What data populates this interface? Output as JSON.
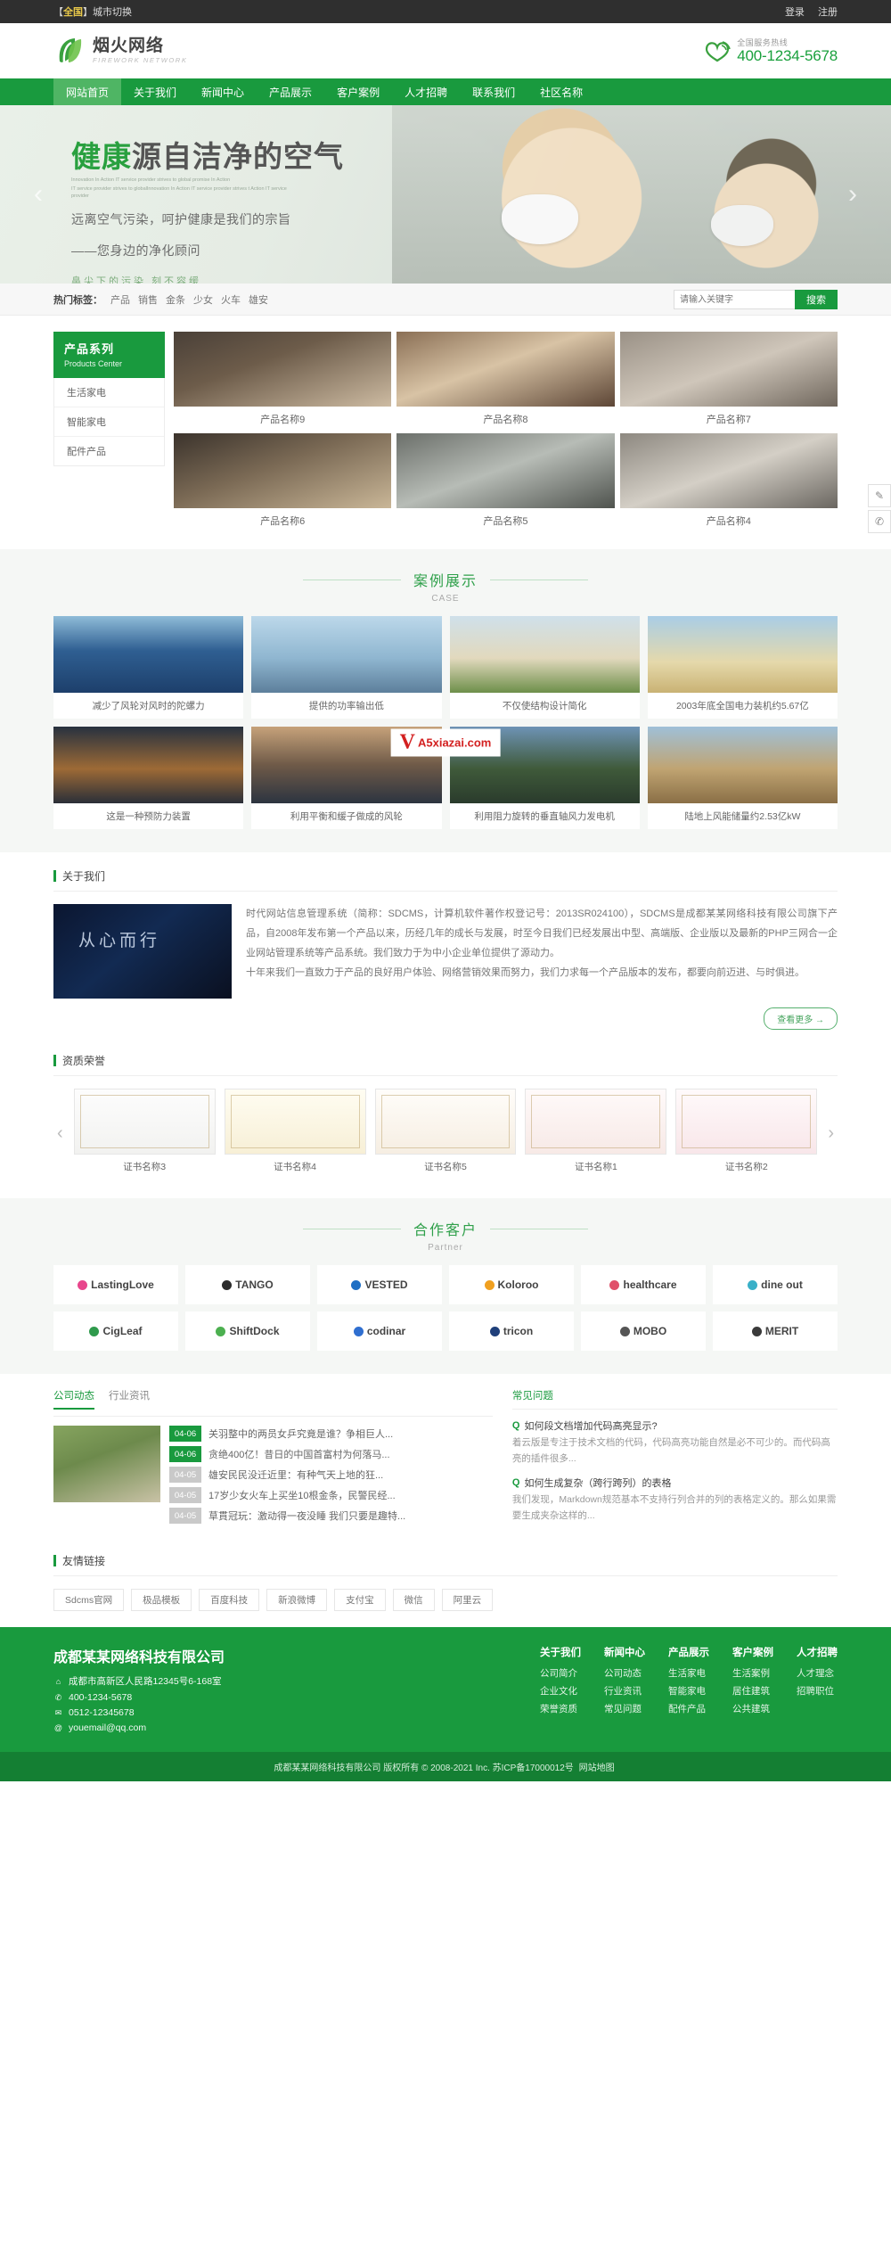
{
  "topbar": {
    "city_prefix": "【",
    "city_name": "全国",
    "city_suffix": "】城市切换",
    "login": "登录",
    "register": "注册"
  },
  "header": {
    "logo_cn": "烟火网络",
    "logo_en": "FIREWORK NETWORK",
    "hotline_label": "全国服务热线",
    "hotline_number": "400-1234-5678"
  },
  "nav": {
    "items": [
      {
        "label": "网站首页",
        "active": true
      },
      {
        "label": "关于我们",
        "active": false
      },
      {
        "label": "新闻中心",
        "active": false
      },
      {
        "label": "产品展示",
        "active": false
      },
      {
        "label": "客户案例",
        "active": false
      },
      {
        "label": "人才招聘",
        "active": false
      },
      {
        "label": "联系我们",
        "active": false
      },
      {
        "label": "社区名称",
        "active": false
      }
    ]
  },
  "hero": {
    "title_green": "健康",
    "title_rest": "源自洁净的空气",
    "sub_en_1": "Innovation In Action IT service provider strives to global promise In Action",
    "sub_en_2": "IT service provider strives to globalInnovation In Action IT service provider strives t Action IT service provider",
    "line1": "远离空气污染，呵护健康是我们的宗旨",
    "line2": "——您身边的净化顾问",
    "slogan": "鼻尖下的污染  刻不容缓",
    "arrow_left": "‹",
    "arrow_right": "›"
  },
  "dock": {
    "items": [
      {
        "name": "message-icon",
        "glyph": "✎"
      },
      {
        "name": "phone-icon",
        "glyph": "✆"
      }
    ]
  },
  "search": {
    "tags_label": "热门标签：",
    "tags": [
      "产品",
      "销售",
      "金条",
      "少女",
      "火车",
      "雄安"
    ],
    "placeholder": "请输入关键字",
    "button": "搜索"
  },
  "products": {
    "side_title_cn": "产品系列",
    "side_title_en": "Products Center",
    "categories": [
      "生活家电",
      "智能家电",
      "配件产品"
    ],
    "items": [
      {
        "caption": "产品名称9",
        "cls": "r1"
      },
      {
        "caption": "产品名称8",
        "cls": "r2"
      },
      {
        "caption": "产品名称7",
        "cls": "r3"
      },
      {
        "caption": "产品名称6",
        "cls": "r4"
      },
      {
        "caption": "产品名称5",
        "cls": "r5"
      },
      {
        "caption": "产品名称4",
        "cls": "r6"
      }
    ]
  },
  "case": {
    "title_cn": "案例展示",
    "title_en": "CASE",
    "watermark_v": "V",
    "watermark_t": "A5xiazai.com",
    "row1": [
      {
        "caption": "减少了风轮对风时的陀螺力",
        "cls": "c1"
      },
      {
        "caption": "提供的功率输出低",
        "cls": "c2"
      },
      {
        "caption": "不仅使结构设计简化",
        "cls": "c3"
      },
      {
        "caption": "2003年底全国电力装机约5.67亿",
        "cls": "c4"
      }
    ],
    "row2": [
      {
        "caption": "这是一种预防力装置",
        "cls": "c5"
      },
      {
        "caption": "利用平衡和缓子做成的风轮",
        "cls": "c6"
      },
      {
        "caption": "利用阻力旋转的垂直轴风力发电机",
        "cls": "c7"
      },
      {
        "caption": "陆地上风能储量约2.53亿kW",
        "cls": "c8"
      }
    ]
  },
  "about": {
    "title": "关于我们",
    "image_text": "从心而行",
    "paragraph1": "时代网站信息管理系统（简称：SDCMS，计算机软件著作权登记号：2013SR024100），SDCMS是成都某某网络科技有限公司旗下产品，自2008年发布第一个产品以来，历经几年的成长与发展，时至今日我们已经发展出中型、高端版、企业版以及最新的PHP三网合一企业网站管理系统等产品系统。我们致力于为中小企业单位提供了源动力。",
    "paragraph2": "十年来我们一直致力于产品的良好用户体验、网络营销效果而努力，我们力求每一个产品版本的发布，都要向前迈进、与时俱进。",
    "more": "查看更多 →"
  },
  "honor": {
    "title": "资质荣誉",
    "arrow_left": "‹",
    "arrow_right": "›",
    "items": [
      {
        "caption": "证书名称3",
        "cls": "h1c"
      },
      {
        "caption": "证书名称4",
        "cls": "h2c"
      },
      {
        "caption": "证书名称5",
        "cls": "h3c"
      },
      {
        "caption": "证书名称1",
        "cls": "h4c"
      },
      {
        "caption": "证书名称2",
        "cls": "h5c"
      }
    ]
  },
  "partner": {
    "title_cn": "合作客户",
    "title_en": "Partner",
    "row1": [
      {
        "name": "LastingLove",
        "color": "#e8468c"
      },
      {
        "name": "TANGO",
        "color": "#2b2b2b"
      },
      {
        "name": "VESTED",
        "color": "#1e6fc4"
      },
      {
        "name": "Koloroo",
        "color": "#f0a020"
      },
      {
        "name": "healthcare",
        "color": "#e0506a"
      },
      {
        "name": "dine out",
        "color": "#3ab0c8"
      }
    ],
    "row2": [
      {
        "name": "CigLeaf",
        "color": "#2f9a4c"
      },
      {
        "name": "ShiftDock",
        "color": "#4cb050"
      },
      {
        "name": "codinar",
        "color": "#2f6fd0"
      },
      {
        "name": "tricon",
        "color": "#1f3f7a"
      },
      {
        "name": "MOBO",
        "color": "#555555"
      },
      {
        "name": "MERIT",
        "color": "#3a3a3a"
      }
    ]
  },
  "news": {
    "tabs": [
      {
        "label": "公司动态",
        "active": true
      },
      {
        "label": "行业资讯",
        "active": false
      }
    ],
    "items": [
      {
        "date": "04-06",
        "title": "关羽整中的两员女乒究竟是谁？争相巨人...",
        "highlight": true
      },
      {
        "date": "04-06",
        "title": "贪绝400亿！昔日的中国首富村为何落马...",
        "highlight": true
      },
      {
        "date": "04-05",
        "title": "雄安民民没迁近里：有种气天上地的狂...",
        "highlight": false
      },
      {
        "date": "04-05",
        "title": "17岁少女火车上买坐10根金条，民警民经...",
        "highlight": false
      },
      {
        "date": "04-05",
        "title": "草貫冠玩：激动得一夜没睡 我们只要是趣特...",
        "highlight": false
      }
    ],
    "faq_title": "常见问题",
    "faqs": [
      {
        "q_mark": "Q",
        "question": "如何段文档增加代码高亮显示?",
        "answer": "着云版是专注于技术文档的代码，代码高亮功能自然是必不可少的。而代码高亮的插件很多..."
      },
      {
        "q_mark": "Q",
        "question": "如何生成复杂（跨行跨列）的表格",
        "answer": "我们发现，Markdown规范基本不支持行列合并的列的表格定义的。那么如果需要生成夹杂这样的..."
      }
    ]
  },
  "friendlinks": {
    "title": "友情链接",
    "items": [
      "Sdcms官网",
      "极品模板",
      "百度科技",
      "新浪微博",
      "支付宝",
      "微信",
      "阿里云"
    ]
  },
  "footer": {
    "company": "成都某某网络科技有限公司",
    "address": "成都市高新区人民路12345号6-168室",
    "tel": "400-1234-5678",
    "fax": "0512-12345678",
    "email": "youemail@qq.com",
    "icon_address": "⌂",
    "icon_tel": "✆",
    "icon_fax": "✉",
    "icon_email": "@",
    "columns": [
      {
        "title": "关于我们",
        "links": [
          "公司简介",
          "企业文化",
          "荣誉资质"
        ]
      },
      {
        "title": "新闻中心",
        "links": [
          "公司动态",
          "行业资讯",
          "常见问题"
        ]
      },
      {
        "title": "产品展示",
        "links": [
          "生活家电",
          "智能家电",
          "配件产品"
        ]
      },
      {
        "title": "客户案例",
        "links": [
          "生活案例",
          "居住建筑",
          "公共建筑"
        ]
      },
      {
        "title": "人才招聘",
        "links": [
          "人才理念",
          "招聘职位"
        ]
      }
    ],
    "copyright": "成都某某网络科技有限公司   版权所有 © 2008-2021 Inc.   苏ICP备17000012号",
    "sitemap": "网站地图"
  },
  "colors": {
    "green": "#199a3e",
    "green_light": "#4fb564",
    "dark": "#2f2f2f",
    "accent_yellow": "#e8c84a"
  }
}
